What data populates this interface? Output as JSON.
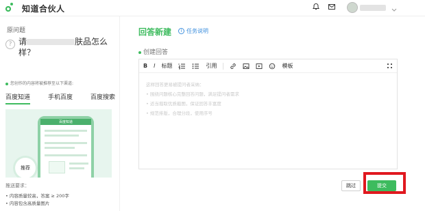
{
  "header": {
    "brand": "知道合伙人",
    "icons": {
      "bell": "bell-icon",
      "mail": "mail-icon",
      "chevron": "chevron-down-icon"
    }
  },
  "question": {
    "label": "原问题",
    "title_start": "请",
    "title_end": "肤品怎么样？"
  },
  "promotion": {
    "note": "您创作的内容将被推荐至以下渠道:",
    "tabs": [
      "百度知道",
      "手机百度",
      "百度搜索"
    ],
    "phone_title": "百度知道",
    "badge": "推荐"
  },
  "requirements": {
    "title": "推送要求：",
    "items": [
      "• 内容质量较高，答案 ≥ 200字",
      "• 内容包含高质量图片"
    ]
  },
  "editor": {
    "page_title": "回答新建",
    "task_link": "任务说明",
    "create_label": "创建回答",
    "toolbar": {
      "bold": "B",
      "italic": "I",
      "heading": "标题",
      "quote": "引用",
      "template": "模板"
    },
    "placeholder_lines": [
      "这样回答更易被提问者采纳：",
      "• 围绕问题核心完整回答问题，满足提问者需求",
      "• 适当裁取优质截图，保证回答丰富度",
      "• 规范排版，合理分段，使用序号"
    ]
  },
  "actions": {
    "skip": "跳过",
    "submit": "提交"
  },
  "colors": {
    "accent": "#3dbb5e",
    "link": "#3d8fdd",
    "highlight": "#e0181f"
  }
}
